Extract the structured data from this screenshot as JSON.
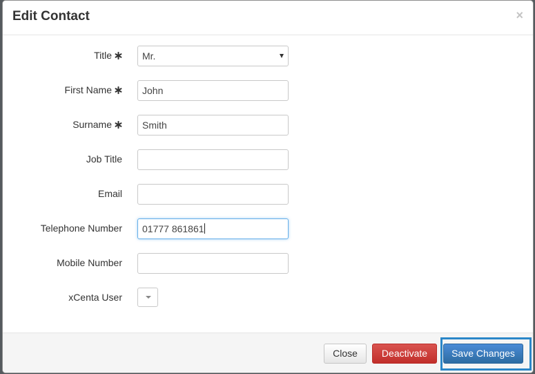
{
  "dialog": {
    "title": "Edit Contact",
    "close_symbol": "×"
  },
  "form": {
    "title": {
      "label": "Title",
      "required": true,
      "value": "Mr."
    },
    "first_name": {
      "label": "First Name",
      "required": true,
      "value": "John"
    },
    "surname": {
      "label": "Surname",
      "required": true,
      "value": "Smith"
    },
    "job_title": {
      "label": "Job Title",
      "value": ""
    },
    "email": {
      "label": "Email",
      "value": ""
    },
    "telephone": {
      "label": "Telephone Number",
      "value": "01777 861861"
    },
    "mobile": {
      "label": "Mobile Number",
      "value": ""
    },
    "xcenta_user": {
      "label": "xCenta User",
      "value": ""
    }
  },
  "footer": {
    "close_label": "Close",
    "deactivate_label": "Deactivate",
    "save_label": "Save Changes"
  },
  "colors": {
    "primary": "#3276b1",
    "danger": "#d2322d",
    "highlight": "#2a86c8",
    "focus": "#66afe9"
  },
  "icons": {
    "required": "asterisk-icon",
    "dropdown": "caret-down-icon",
    "close": "close-icon"
  }
}
